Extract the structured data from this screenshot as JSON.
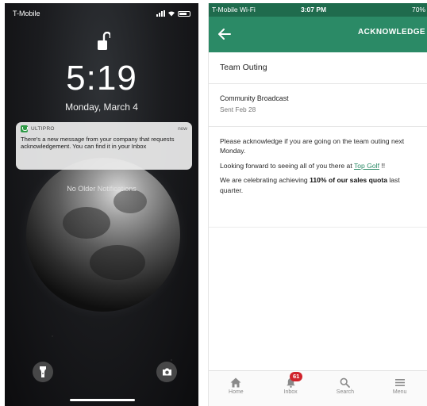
{
  "lock_screen": {
    "carrier": "T-Mobile",
    "time": "5:19",
    "date": "Monday, March 4",
    "notification": {
      "app_name": "ULTIPRO",
      "time": "now",
      "message": "There's a new message from your company that requests acknowledgement. You can find it in your Inbox",
      "app_icon": "ultipro-logo"
    },
    "no_older_text": "No Older Notifications",
    "quick_actions": [
      "flashlight-icon",
      "camera-icon"
    ]
  },
  "app_screen": {
    "status_bar": {
      "carrier": "T-Mobile Wi-Fi",
      "time": "3:07 PM",
      "battery": "70%"
    },
    "app_bar": {
      "back_icon": "back-arrow-icon",
      "action_label": "ACKNOWLEDGE",
      "color": "#2b8a66"
    },
    "message": {
      "subject": "Team Outing",
      "sender": "Community Broadcast",
      "sent": "Sent Feb 28",
      "para1": "Please acknowledge if you are going on the team outing next Monday.",
      "para2_prefix": "Looking forward to seeing all of you there at",
      "para2_link": "Top Golf",
      "para2_suffix": "!!",
      "para3_prefix": "We are celebrating achieving",
      "para3_bold": "110% of our sales quota",
      "para3_suffix": "last quarter."
    },
    "tabs": [
      {
        "label": "Home",
        "icon": "home-icon"
      },
      {
        "label": "Inbox",
        "icon": "bell-icon",
        "badge": "61"
      },
      {
        "label": "Search",
        "icon": "search-icon"
      },
      {
        "label": "Menu",
        "icon": "menu-icon"
      }
    ],
    "badge_color": "#d0222b"
  }
}
